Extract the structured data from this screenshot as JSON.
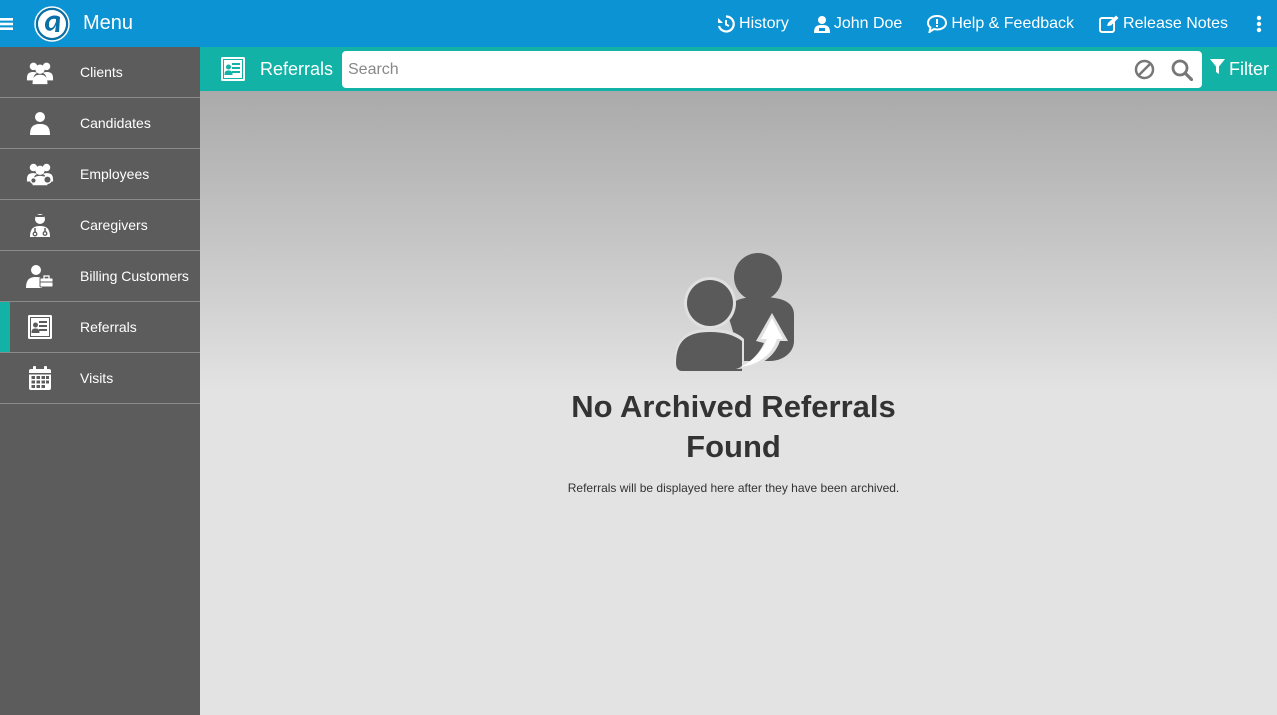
{
  "topbar": {
    "menu_label": "Menu",
    "actions": [
      {
        "label": "History",
        "icon": "history-icon"
      },
      {
        "label": "John Doe",
        "icon": "user-icon"
      },
      {
        "label": "Help & Feedback",
        "icon": "feedback-icon"
      },
      {
        "label": "Release Notes",
        "icon": "edit-icon"
      }
    ]
  },
  "sidebar": {
    "items": [
      {
        "label": "Clients",
        "icon": "clients-icon"
      },
      {
        "label": "Candidates",
        "icon": "candidate-icon"
      },
      {
        "label": "Employees",
        "icon": "employees-icon"
      },
      {
        "label": "Caregivers",
        "icon": "caregiver-icon"
      },
      {
        "label": "Billing Customers",
        "icon": "billing-customer-icon"
      },
      {
        "label": "Referrals",
        "icon": "referrals-icon",
        "active": true
      },
      {
        "label": "Visits",
        "icon": "calendar-icon"
      }
    ]
  },
  "subheader": {
    "title": "Referrals",
    "search_placeholder": "Search",
    "search_value": "",
    "filter_label": "Filter"
  },
  "empty_state": {
    "icon": "referral-users-icon",
    "title": "No Archived Referrals Found",
    "description": "Referrals will be displayed here after they have been archived."
  },
  "colors": {
    "topbar": "#0b93d3",
    "accent": "#12b3a6",
    "sidebar": "#5c5c5c",
    "icon_gray": "#5a5a5a"
  }
}
